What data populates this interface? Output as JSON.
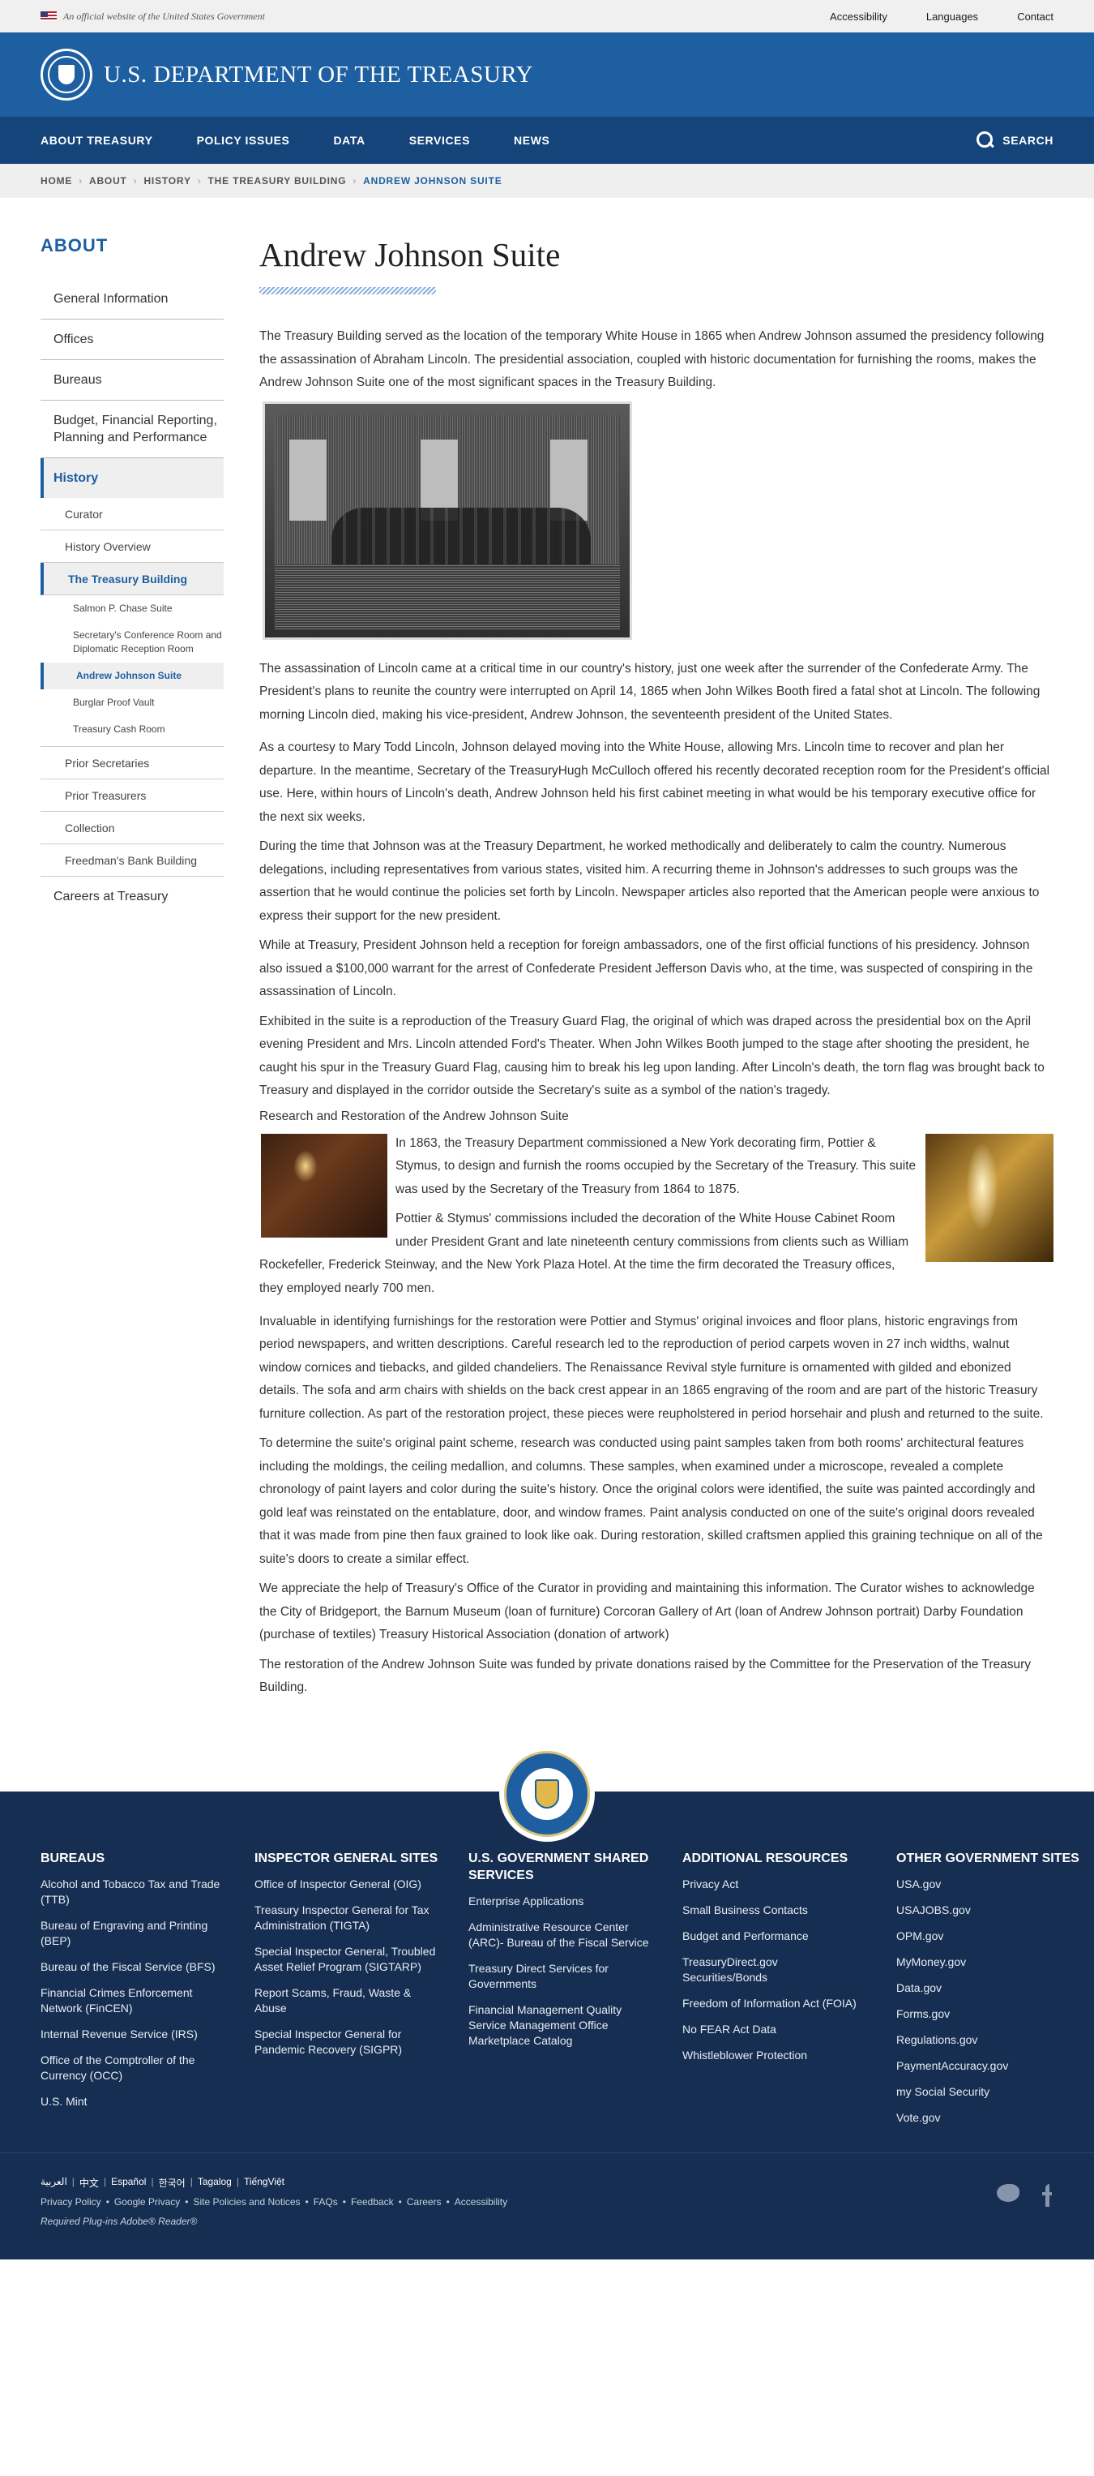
{
  "official_banner": {
    "text": "An official website of the United States Government",
    "links": [
      "Accessibility",
      "Languages",
      "Contact"
    ]
  },
  "header": {
    "title": "U.S. DEPARTMENT OF THE TREASURY"
  },
  "nav": {
    "items": [
      "ABOUT TREASURY",
      "POLICY ISSUES",
      "DATA",
      "SERVICES",
      "NEWS"
    ],
    "search_label": "SEARCH"
  },
  "breadcrumb": [
    "HOME",
    "ABOUT",
    "HISTORY",
    "THE TREASURY BUILDING",
    "ANDREW JOHNSON SUITE"
  ],
  "sidebar": {
    "heading": "ABOUT",
    "items": [
      "General Information",
      "Offices",
      "Bureaus",
      "Budget, Financial Reporting, Planning and Performance",
      "History"
    ],
    "history_sub": [
      "Curator",
      "History Overview",
      "The Treasury Building"
    ],
    "building_sub": [
      "Salmon P. Chase Suite",
      "Secretary's Conference Room and Diplomatic Reception Room",
      "Andrew Johnson Suite",
      "Burglar Proof Vault",
      "Treasury Cash Room"
    ],
    "history_sub2": [
      "Prior Secretaries",
      "Prior Treasurers",
      "Collection",
      "Freedman's Bank Building"
    ],
    "careers": "Careers at Treasury"
  },
  "content": {
    "title": "Andrew Johnson Suite",
    "p1": "The Treasury Building served as the location of the temporary White House in 1865 when Andrew Johnson assumed the presidency following the assassination of Abraham Lincoln. The presidential association, coupled with historic documentation for furnishing the rooms, makes the Andrew Johnson Suite one of the most significant spaces in the Treasury Building.",
    "p2": "The assassination of Lincoln came at a critical time in our country's history, just one week after the surrender of the Confederate Army. The President's plans to reunite the country were interrupted on April 14, 1865 when John Wilkes Booth fired a fatal shot at Lincoln. The following morning Lincoln died, making his vice-president, Andrew Johnson, the seventeenth president of the United States.",
    "p3": "As a courtesy to Mary Todd Lincoln, Johnson delayed moving into the White House, allowing Mrs. Lincoln time to recover and plan her departure. In the meantime, Secretary of the TreasuryHugh McCulloch offered his recently decorated reception room for the President's official use. Here, within hours of Lincoln's death, Andrew Johnson held his first cabinet meeting in what would be his temporary executive office for the next six weeks.",
    "p4": "During the time that Johnson was at the Treasury Department, he worked methodically and deliberately to calm the country. Numerous delegations, including representatives from various states, visited him. A recurring theme in Johnson's addresses to such groups was the assertion that he would continue the policies set forth by Lincoln. Newspaper articles also reported that the American people were anxious to express their support for the new president.",
    "p5": "While at Treasury, President Johnson held a reception for foreign ambassadors, one of the first official functions of his presidency. Johnson also issued a $100,000 warrant for the arrest of Confederate President Jefferson Davis who, at the time, was suspected of conspiring in the assassination of Lincoln.",
    "p6": "Exhibited in the suite is a reproduction of the Treasury Guard Flag, the original of which was draped across the presidential box on the April evening President and Mrs. Lincoln attended Ford's Theater. When John Wilkes Booth jumped to the stage after shooting the president, he caught his spur in the Treasury Guard Flag, causing him to break his leg upon landing. After Lincoln's death, the torn flag was brought back to Treasury and displayed in the corridor outside the Secretary's suite as a symbol of the nation's tragedy.",
    "subheading": "Research and Restoration of the Andrew Johnson Suite",
    "p7": "In 1863, the Treasury Department commissioned a New York decorating firm, Pottier & Stymus, to design and furnish the rooms occupied by the Secretary of the Treasury. This suite was used by the Secretary of the Treasury from 1864 to 1875.",
    "p8": "Pottier & Stymus' commissions included the decoration of the White House Cabinet Room under President Grant and late nineteenth century commissions from clients such as William Rockefeller, Frederick Steinway, and the New York Plaza Hotel. At the time the firm decorated the Treasury offices, they employed nearly 700 men.",
    "p9": "Invaluable in identifying furnishings for the restoration were Pottier and Stymus' original invoices and floor plans, historic engravings from period newspapers, and written descriptions. Careful research led to the reproduction of period carpets woven in 27 inch widths, walnut window cornices and tiebacks, and gilded chandeliers. The Renaissance Revival style furniture is ornamented with gilded and ebonized details. The sofa and arm chairs with shields on the back crest appear in an 1865 engraving of the room and are part of the historic Treasury furniture collection. As part of the restoration project, these pieces were reupholstered in period horsehair and plush and returned to the suite.",
    "p10": "To determine the suite's original paint scheme, research was conducted using paint samples taken from both rooms' architectural features including the moldings, the ceiling medallion, and columns. These samples, when examined under a microscope, revealed a complete chronology of paint layers and color during the suite's history. Once the original colors were identified, the suite was painted accordingly and gold leaf was reinstated on the entablature, door, and window frames. Paint analysis conducted on one of the suite's original doors revealed that it was made from pine then faux grained to look like oak. During restoration, skilled craftsmen applied this graining technique on all of the suite's doors to create a similar effect.",
    "p11": "We appreciate the help of Treasury's Office of the Curator in providing and maintaining this information. The Curator wishes to acknowledge the City of Bridgeport, the Barnum Museum (loan of furniture) Corcoran Gallery of Art (loan of Andrew Johnson portrait) Darby Foundation (purchase of textiles) Treasury Historical Association (donation of artwork)",
    "p12": "The restoration of the Andrew Johnson Suite was funded by private donations raised by the Committee for the Preservation of the Treasury Building."
  },
  "footer": {
    "columns": [
      {
        "heading": "BUREAUS",
        "items": [
          "Alcohol and Tobacco Tax and Trade (TTB)",
          "Bureau of Engraving and Printing (BEP)",
          "Bureau of the Fiscal Service (BFS)",
          "Financial Crimes Enforcement Network (FinCEN)",
          "Internal Revenue Service (IRS)",
          "Office of the Comptroller of the Currency (OCC)",
          "U.S. Mint"
        ]
      },
      {
        "heading": "INSPECTOR GENERAL SITES",
        "items": [
          "Office of Inspector General (OIG)",
          "Treasury Inspector General for Tax Administration (TIGTA)",
          "Special Inspector General, Troubled Asset Relief Program (SIGTARP)",
          "Report Scams, Fraud, Waste & Abuse",
          "Special Inspector General for Pandemic Recovery (SIGPR)"
        ]
      },
      {
        "heading": "U.S. GOVERNMENT SHARED SERVICES",
        "items": [
          "Enterprise Applications",
          "Administrative Resource Center (ARC)- Bureau of the Fiscal Service",
          "Treasury Direct Services for Governments",
          "Financial Management Quality Service Management Office Marketplace Catalog"
        ]
      },
      {
        "heading": "ADDITIONAL RESOURCES",
        "items": [
          "Privacy Act",
          "Small Business Contacts",
          "Budget and Performance",
          "TreasuryDirect.gov Securities/Bonds",
          "Freedom of Information Act (FOIA)",
          "No FEAR Act Data",
          "Whistleblower Protection"
        ]
      },
      {
        "heading": "OTHER GOVERNMENT SITES",
        "items": [
          "USA.gov",
          "USAJOBS.gov",
          "OPM.gov",
          "MyMoney.gov",
          "Data.gov",
          "Forms.gov",
          "Regulations.gov",
          "PaymentAccuracy.gov",
          "my Social Security",
          "Vote.gov"
        ]
      }
    ],
    "languages": [
      "العربية",
      "中文",
      "Español",
      "한국어",
      "Tagalog",
      "TiếngViệt"
    ],
    "policy_links": [
      "Privacy Policy",
      "Google Privacy",
      "Site Policies and Notices",
      "FAQs",
      "Feedback",
      "Careers",
      "Accessibility"
    ],
    "plugins": "Required Plug-ins  Adobe® Reader®"
  }
}
